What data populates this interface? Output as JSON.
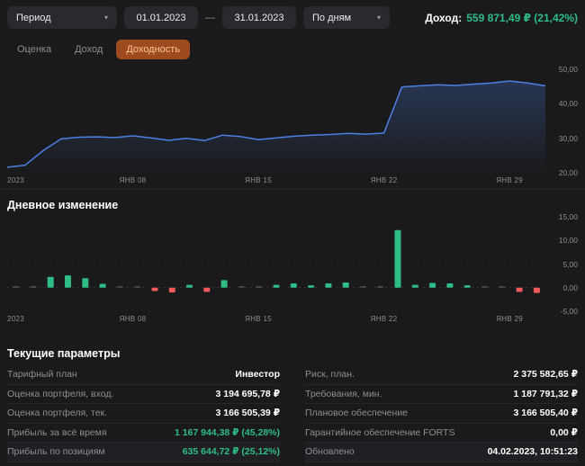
{
  "toolbar": {
    "period_label": "Период",
    "date_from": "01.01.2023",
    "date_separator": "—",
    "date_to": "31.01.2023",
    "granularity_value": "По дням",
    "income_label": "Доход:",
    "income_value": "559 871,49 ₽ (21,42%)"
  },
  "tabs": [
    {
      "id": "otsenka",
      "label": "Оценка",
      "active": false
    },
    {
      "id": "dokhod",
      "label": "Доход",
      "active": false
    },
    {
      "id": "dokhodnost",
      "label": "Доходность",
      "active": true
    }
  ],
  "colors": {
    "green": "#2ebd85",
    "red": "#ef5b5b",
    "line_blue": "#4d7fe3",
    "tab_active_bg": "#9e4b20",
    "tab_active_text": "#ffc39e"
  },
  "sections": {
    "daily_change_title": "Дневное изменение",
    "parameters_title": "Текущие параметры"
  },
  "chart_data": [
    {
      "type": "line",
      "title": "Доходность",
      "legend": "off",
      "grid": "horizontal-dotted",
      "x_ticks": [
        {
          "label": "2023",
          "day": 1
        },
        {
          "label": "ЯНВ 08",
          "day": 8
        },
        {
          "label": "ЯНВ 15",
          "day": 15
        },
        {
          "label": "ЯНВ 22",
          "day": 22
        },
        {
          "label": "ЯНВ 29",
          "day": 29
        }
      ],
      "y_ticks": [
        {
          "label": "50,00",
          "value": 50
        },
        {
          "label": "40,00",
          "value": 40
        },
        {
          "label": "30,00",
          "value": 30
        },
        {
          "label": "20,00",
          "value": 20
        }
      ],
      "ylim": [
        20,
        50
      ],
      "values": [
        21.6,
        22.2,
        26.4,
        29.8,
        30.3,
        30.4,
        30.2,
        30.7,
        30.1,
        29.4,
        30.0,
        29.3,
        30.9,
        30.5,
        29.6,
        30.1,
        30.6,
        30.9,
        31.1,
        31.4,
        31.2,
        31.5,
        44.9,
        45.2,
        45.5,
        45.3,
        45.7,
        46.0,
        46.6,
        46.0,
        45.2
      ]
    },
    {
      "type": "bar",
      "title": "Дневное изменение",
      "legend": "off",
      "grid": "horizontal-dotted",
      "x_ticks": [
        {
          "label": "2023",
          "day": 1
        },
        {
          "label": "ЯНВ 08",
          "day": 8
        },
        {
          "label": "ЯНВ 15",
          "day": 15
        },
        {
          "label": "ЯНВ 22",
          "day": 22
        },
        {
          "label": "ЯНВ 29",
          "day": 29
        }
      ],
      "y_ticks": [
        {
          "label": "15,00",
          "value": 15
        },
        {
          "label": "10,00",
          "value": 10
        },
        {
          "label": "5,00",
          "value": 5
        },
        {
          "label": "0,00",
          "value": 0
        },
        {
          "label": "-5,00",
          "value": -5
        }
      ],
      "ylim": [
        -5,
        15
      ],
      "values": [
        0.1,
        0.1,
        2.3,
        2.6,
        2.0,
        0.8,
        0.1,
        0.1,
        -0.7,
        -1.0,
        0.6,
        -0.9,
        1.6,
        0.1,
        0.1,
        0.6,
        0.9,
        0.5,
        0.9,
        1.1,
        0.1,
        0.1,
        12.2,
        0.6,
        1.0,
        0.9,
        0.5,
        0.1,
        0.1,
        -0.9,
        -1.1
      ]
    }
  ],
  "parameters": {
    "left": [
      {
        "label": "Тарифный план",
        "value": "Инвестор",
        "green": false
      },
      {
        "label": "Оценка портфеля, вход.",
        "value": "3 194 695,78 ₽",
        "green": false
      },
      {
        "label": "Оценка портфеля, тек.",
        "value": "3 166 505,39 ₽",
        "green": false
      },
      {
        "label": "Прибыль за всё время",
        "value": "1 167 944,38 ₽ (45,28%)",
        "green": true
      },
      {
        "label": "Прибыль по позициям",
        "value": "635 644,72 ₽ (25,12%)",
        "green": true
      }
    ],
    "right": [
      {
        "label": "Риск, план.",
        "value": "2 375 582,65 ₽",
        "green": false
      },
      {
        "label": "Требования, мин.",
        "value": "1 187 791,32 ₽",
        "green": false
      },
      {
        "label": "Плановое обеспечение",
        "value": "3 166 505,40 ₽",
        "green": false
      },
      {
        "label": "Гарантийное обеспечение FORTS",
        "value": "0,00 ₽",
        "green": false
      },
      {
        "label": "Обновлено",
        "value": "04.02.2023, 10:51:23",
        "green": false
      }
    ]
  }
}
